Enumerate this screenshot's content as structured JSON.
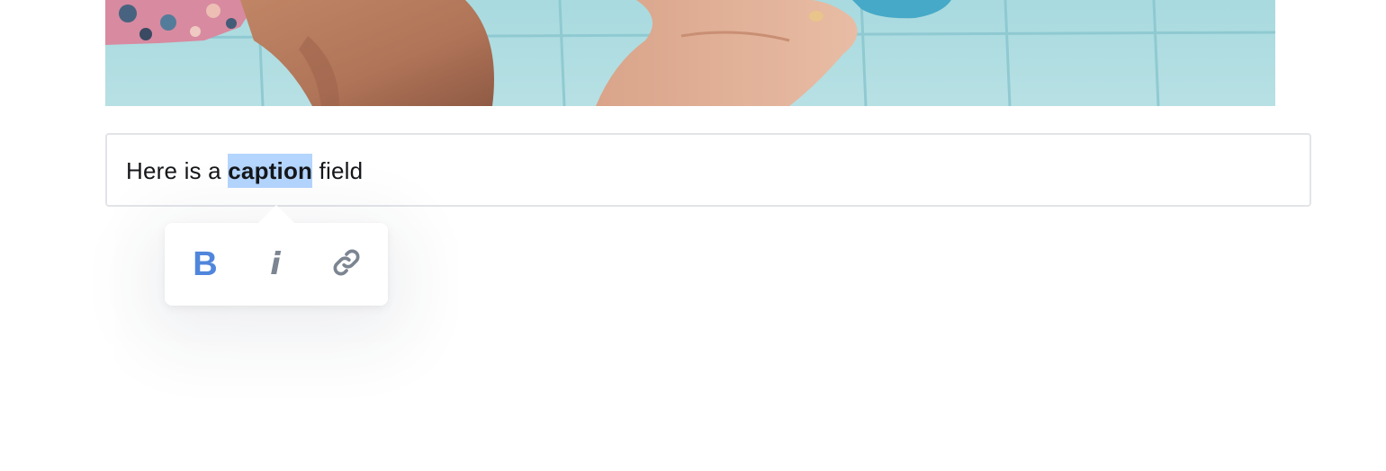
{
  "photo": {
    "alt_name": "pool-photo"
  },
  "caption": {
    "before": "Here is a ",
    "selected": "caption",
    "after": " field"
  },
  "toolbar": {
    "bold_glyph": "B",
    "italic_glyph": "i",
    "link_icon": "link-icon"
  },
  "colors": {
    "selection": "#b4d5fe",
    "bold_active": "#5086dc",
    "icon_gray": "#7c8592",
    "field_border": "#e2e4e8"
  }
}
